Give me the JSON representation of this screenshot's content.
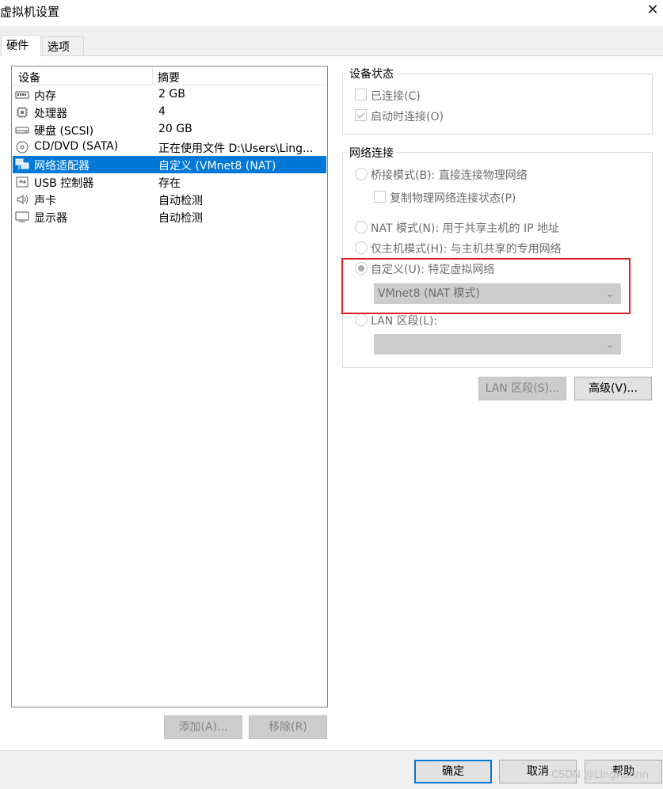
{
  "window": {
    "title": "虚拟机设置"
  },
  "tabs": [
    "硬件",
    "选项"
  ],
  "device_list": {
    "headers": {
      "device": "设备",
      "summary": "摘要"
    },
    "rows": [
      {
        "icon": "memory-icon",
        "device": "内存",
        "summary": "2 GB"
      },
      {
        "icon": "processor-icon",
        "device": "处理器",
        "summary": "4"
      },
      {
        "icon": "hard-disk-icon",
        "device": "硬盘 (SCSI)",
        "summary": "20 GB"
      },
      {
        "icon": "cd-dvd-icon",
        "device": "CD/DVD (SATA)",
        "summary": "正在使用文件 D:\\Users\\Ling..."
      },
      {
        "icon": "network-adapter-icon",
        "device": "网络适配器",
        "summary": "自定义 (VMnet8 (NAT)",
        "selected": true
      },
      {
        "icon": "usb-icon",
        "device": "USB 控制器",
        "summary": "存在"
      },
      {
        "icon": "sound-card-icon",
        "device": "声卡",
        "summary": "自动检测"
      },
      {
        "icon": "display-icon",
        "device": "显示器",
        "summary": "自动检测"
      }
    ],
    "add_button": "添加(A)...",
    "remove_button": "移除(R)"
  },
  "device_status": {
    "title": "设备状态",
    "connected": {
      "label": "已连接(C)",
      "checked": false
    },
    "connect_at_power_on": {
      "label": "启动时连接(O)",
      "checked": true
    }
  },
  "network_connection": {
    "title": "网络连接",
    "bridged": {
      "label": "桥接模式(B): 直接连接物理网络",
      "selected": false
    },
    "replicate": {
      "label": "复制物理网络连接状态(P)",
      "checked": false
    },
    "nat": {
      "label": "NAT 模式(N): 用于共享主机的 IP 地址",
      "selected": false
    },
    "host_only": {
      "label": "仅主机模式(H): 与主机共享的专用网络",
      "selected": false
    },
    "custom": {
      "label": "自定义(U): 特定虚拟网络",
      "selected": true,
      "value": "VMnet8 (NAT 模式)"
    },
    "lan_segment": {
      "label": "LAN 区段(L):",
      "selected": false,
      "value": ""
    }
  },
  "buttons": {
    "lan_segments": "LAN 区段(S)...",
    "advanced": "高级(V)...",
    "ok": "确定",
    "cancel": "取消",
    "help": "帮助"
  },
  "watermark": "CSDN @LingRannn",
  "colors": {
    "selection": "#0078d7",
    "highlight_box": "#e02020"
  }
}
